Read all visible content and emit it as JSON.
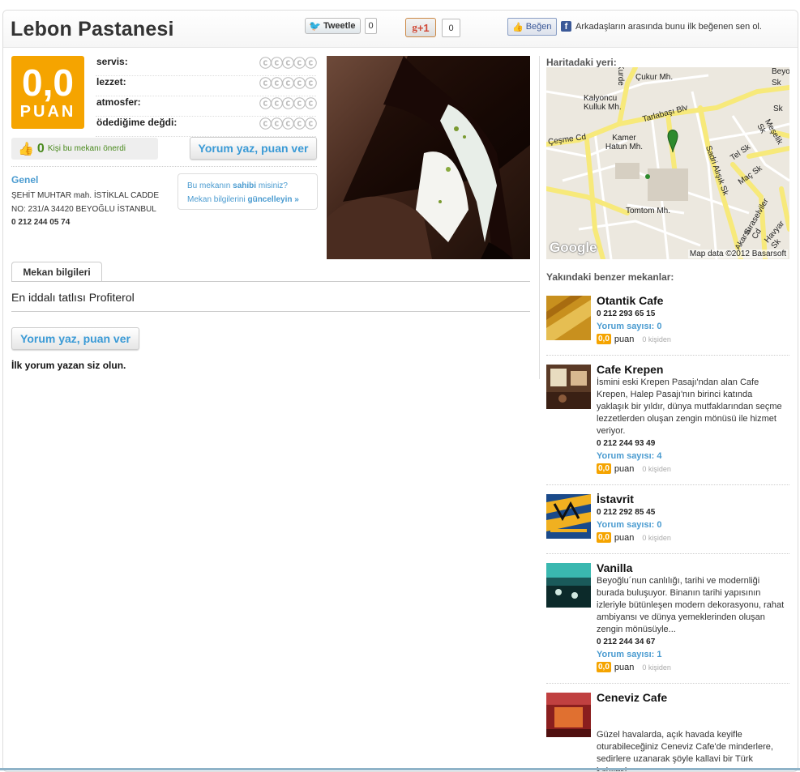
{
  "title": "Lebon Pastanesi",
  "social": {
    "tweet_label": "Tweetle",
    "tweet_count": "0",
    "gplus_label": "+1",
    "gplus_count": "0",
    "like_label": "Beğen",
    "fb_text": "Arkadaşların arasında bunu ilk beğenen sen ol."
  },
  "score": {
    "value": "0,0",
    "label": "PUAN"
  },
  "ratings": [
    {
      "label": "servis:",
      "stars": 0,
      "max": 5
    },
    {
      "label": "lezzet:",
      "stars": 0,
      "max": 5
    },
    {
      "label": "atmosfer:",
      "stars": 0,
      "max": 5
    },
    {
      "label": "ödediğime değdi:",
      "stars": 0,
      "max": 5
    }
  ],
  "recommend": {
    "count": "0",
    "text": "Kişi bu mekanı önerdi"
  },
  "review_button": "Yorum yaz, puan ver",
  "info": {
    "section": "Genel",
    "address_line1": "ŞEHİT MUHTAR mah. İSTİKLAL CADDE",
    "address_line2": "NO: 231/A 34420 BEYOĞLU İSTANBUL",
    "phone": "0 212 244 05 74"
  },
  "owner": {
    "q_prefix": "Bu mekanın ",
    "q_bold": "sahibi",
    "q_suffix": " misiniz?",
    "u_prefix": "Mekan bilgilerini ",
    "u_bold": "güncelleyin »"
  },
  "tab_label": "Mekan bilgileri",
  "description": "En iddalı tatlısı Profiterol",
  "first_review_text": "İlk yorum yazan siz olun.",
  "map": {
    "title": "Haritadaki yeri:",
    "google": "Google",
    "attribution": "Map data ©2012 Basarsoft",
    "labels": [
      "Çukur Mh.",
      "Kalyoncu Kulluk Mh.",
      "Tarlabaşı Blv",
      "Çeşme Cd",
      "Kamer Hatun Mh.",
      "Sadri Alışık Sk",
      "Tomtom Mh.",
      "Meşelik Sk",
      "Tel Sk",
      "Maç Sk",
      "Sıraselviler Cd",
      "Havyar Sk",
      "Akarsu",
      "Kurde",
      "Sk",
      "Beyoğ",
      "Sk"
    ]
  },
  "nearby": {
    "title": "Yakındaki benzer mekanlar:",
    "count_prefix": "Yorum sayısı: ",
    "score_unit": "puan",
    "kisiden": "0 kişiden",
    "items": [
      {
        "name": "Otantik Cafe",
        "desc": "",
        "phone": "0 212 293 65 15",
        "count": "Yorum sayısı: 0",
        "score": "0,0"
      },
      {
        "name": "Cafe Krepen",
        "desc": "İsmini eski Krepen Pasajı'ndan alan Cafe Krepen, Halep Pasajı'nın birinci katında yaklaşık bir yıldır, dünya mutfaklarından seçme lezzetlerden oluşan zengin mönüsü ile hizmet veriyor.",
        "phone": "0 212 244 93 49",
        "count": "Yorum sayısı: 4",
        "score": "0,0"
      },
      {
        "name": "İstavrit",
        "desc": "",
        "phone": "0 212 292 85 45",
        "count": "Yorum sayısı: 0",
        "score": "0,0"
      },
      {
        "name": "Vanilla",
        "desc": "Beyoğlu´nun canlılığı, tarihi ve modernliği burada buluşuyor. Binanın tarihi yapısının izleriyle bütünleşen modern dekorasyonu, rahat ambiyansı ve dünya yemeklerinden oluşan zengin mönüsüyle...",
        "phone": "0 212 244 34 67",
        "count": "Yorum sayısı: 1",
        "score": "0,0"
      },
      {
        "name": "Ceneviz Cafe",
        "desc": "Güzel havalarda, açık havada keyifle oturabileceğiniz Ceneviz Cafe'de minderlere, sedirlere uzanarak şöyle kallavi bir Türk kahvesi",
        "phone": "",
        "count": "",
        "score": ""
      }
    ]
  }
}
